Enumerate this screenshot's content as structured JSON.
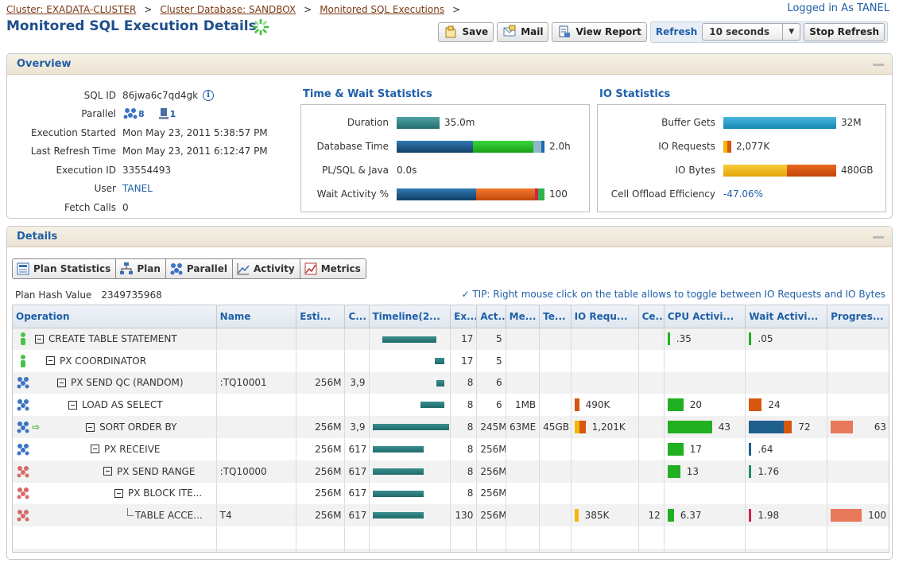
{
  "header": {
    "breadcrumbs": [
      {
        "label": "Cluster: EXADATA-CLUSTER"
      },
      {
        "label": "Cluster Database: SANDBOX"
      },
      {
        "label": "Monitored SQL Executions"
      }
    ],
    "breadcrumb_sep": ">",
    "logged_in": "Logged in As TANEL",
    "title": "Monitored SQL Execution Details",
    "spinner_icon": "loading-spinner-icon"
  },
  "toolbar": {
    "save_label": "Save",
    "mail_label": "Mail",
    "view_report_label": "View Report",
    "refresh_label": "Refresh",
    "refresh_interval": "10 seconds",
    "stop_refresh_label": "Stop Refresh"
  },
  "overview": {
    "title": "Overview",
    "sql_id_label": "SQL ID",
    "sql_id": "86jwa6c7qd4gk",
    "parallel_label": "Parallel",
    "parallel_servers": "8",
    "parallel_instances": "1",
    "exec_started_label": "Execution Started",
    "exec_started": "Mon May 23, 2011 5:38:57 PM",
    "last_refresh_label": "Last Refresh Time",
    "last_refresh": "Mon May 23, 2011 6:12:47 PM",
    "exec_id_label": "Execution ID",
    "exec_id": "33554493",
    "user_label": "User",
    "user": "TANEL",
    "fetch_calls_label": "Fetch Calls",
    "fetch_calls": "0"
  },
  "time_wait": {
    "title": "Time & Wait Statistics",
    "duration_label": "Duration",
    "duration": "35.0m",
    "db_time_label": "Database Time",
    "db_time": "2.0h",
    "plsql_label": "PL/SQL & Java",
    "plsql": "0.0s",
    "wait_activity_label": "Wait Activity %",
    "wait_activity": "100"
  },
  "io_stats": {
    "title": "IO Statistics",
    "buffer_gets_label": "Buffer Gets",
    "buffer_gets": "32M",
    "io_requests_label": "IO Requests",
    "io_requests": "2,077K",
    "io_bytes_label": "IO Bytes",
    "io_bytes": "480GB",
    "cell_offload_label": "Cell Offload Efficiency",
    "cell_offload": "-47.06%"
  },
  "details": {
    "title": "Details",
    "tabs": [
      "Plan Statistics",
      "Plan",
      "Parallel",
      "Activity",
      "Metrics"
    ],
    "plan_hash_label": "Plan Hash Value",
    "plan_hash": "2349735968",
    "tip": "TIP: Right mouse click on the table allows to toggle between IO Requests and IO Bytes",
    "columns": [
      "Operation",
      "Name",
      "Esti...",
      "C...",
      "Timeline(2...",
      "Ex...",
      "Act...",
      "Me...",
      "Te...",
      "IO Requ...",
      "Ce...",
      "CPU Activi...",
      "Wait Activi...",
      "Progres..."
    ],
    "rows": [
      {
        "op": "CREATE TABLE STATEMENT",
        "name": "",
        "est": "",
        "cost": "",
        "ex": "17",
        "act": "5",
        "mem": "",
        "temp": "",
        "io": "",
        "cell": "",
        "cpu": ".35",
        "wait": ".05",
        "prog": ""
      },
      {
        "op": "PX COORDINATOR",
        "name": "",
        "est": "",
        "cost": "",
        "ex": "17",
        "act": "5",
        "mem": "",
        "temp": "",
        "io": "",
        "cell": "",
        "cpu": "",
        "wait": "",
        "prog": ""
      },
      {
        "op": "PX SEND QC (RANDOM)",
        "name": ":TQ10001",
        "est": "256M",
        "cost": "3,9",
        "ex": "8",
        "act": "6",
        "mem": "",
        "temp": "",
        "io": "",
        "cell": "",
        "cpu": "",
        "wait": "",
        "prog": ""
      },
      {
        "op": "LOAD AS SELECT",
        "name": "",
        "est": "",
        "cost": "",
        "ex": "8",
        "act": "6",
        "mem": "1MB",
        "temp": "",
        "io": "490K",
        "cell": "",
        "cpu": "20",
        "wait": "24",
        "prog": ""
      },
      {
        "op": "SORT ORDER BY",
        "name": "",
        "est": "256M",
        "cost": "3,9",
        "ex": "8",
        "act": "245M",
        "mem": "63ME",
        "temp": "45GB",
        "io": "1,201K",
        "cell": "",
        "cpu": "43",
        "wait": "72",
        "prog": "63"
      },
      {
        "op": "PX RECEIVE",
        "name": "",
        "est": "256M",
        "cost": "617",
        "ex": "8",
        "act": "256M",
        "mem": "",
        "temp": "",
        "io": "",
        "cell": "",
        "cpu": "17",
        "wait": ".64",
        "prog": ""
      },
      {
        "op": "PX SEND RANGE",
        "name": ":TQ10000",
        "est": "256M",
        "cost": "617",
        "ex": "8",
        "act": "256M",
        "mem": "",
        "temp": "",
        "io": "",
        "cell": "",
        "cpu": "13",
        "wait": "1.76",
        "prog": ""
      },
      {
        "op": "PX BLOCK ITE...",
        "name": "",
        "est": "256M",
        "cost": "617",
        "ex": "8",
        "act": "256M",
        "mem": "",
        "temp": "",
        "io": "",
        "cell": "",
        "cpu": "",
        "wait": "",
        "prog": ""
      },
      {
        "op": "TABLE ACCE...",
        "name": "T4",
        "est": "256M",
        "cost": "617",
        "ex": "130",
        "act": "256M",
        "mem": "",
        "temp": "",
        "io": "385K",
        "cell": "12",
        "cpu": "6.37",
        "wait": "1.98",
        "prog": "100"
      }
    ]
  },
  "colors": {
    "accent": "#1f5fa8",
    "timeline": "#2a7c7c",
    "cpu": "#21b021",
    "user_io": "#1e5f8c",
    "io_orange": "#d9560f",
    "io_yellow": "#f2b70c"
  }
}
